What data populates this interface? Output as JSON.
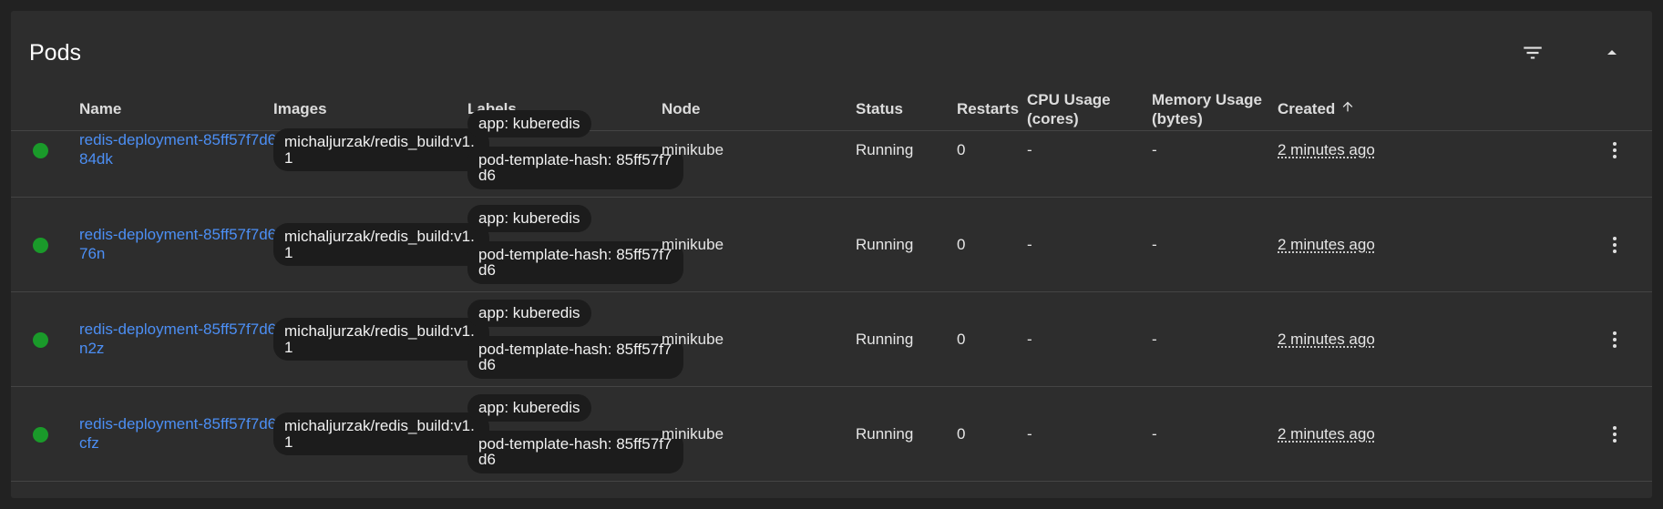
{
  "card": {
    "title": "Pods",
    "filter_icon": "filter-icon",
    "collapse_icon": "chevron-up-icon"
  },
  "columns": {
    "name": "Name",
    "images": "Images",
    "labels": "Labels",
    "node": "Node",
    "status": "Status",
    "restarts": "Restarts",
    "cpu": "CPU Usage (cores)",
    "memory": "Memory Usage (bytes)",
    "created": "Created",
    "created_sort_icon": "arrow-up-icon"
  },
  "rows": [
    {
      "name": "redis-deployment-85ff57f7d6-g84dk",
      "image": "michaljurzak/redis_build:v1.1",
      "label1": "app: kuberedis",
      "label2": "pod-template-hash: 85ff57f7d6",
      "node": "minikube",
      "status": "Running",
      "restarts": "0",
      "cpu": "-",
      "memory": "-",
      "created": "2 minutes ago"
    },
    {
      "name": "redis-deployment-85ff57f7d6-gl76n",
      "image": "michaljurzak/redis_build:v1.1",
      "label1": "app: kuberedis",
      "label2": "pod-template-hash: 85ff57f7d6",
      "node": "minikube",
      "status": "Running",
      "restarts": "0",
      "cpu": "-",
      "memory": "-",
      "created": "2 minutes ago"
    },
    {
      "name": "redis-deployment-85ff57f7d6-gsn2z",
      "image": "michaljurzak/redis_build:v1.1",
      "label1": "app: kuberedis",
      "label2": "pod-template-hash: 85ff57f7d6",
      "node": "minikube",
      "status": "Running",
      "restarts": "0",
      "cpu": "-",
      "memory": "-",
      "created": "2 minutes ago"
    },
    {
      "name": "redis-deployment-85ff57f7d6-tkcfz",
      "image": "michaljurzak/redis_build:v1.1",
      "label1": "app: kuberedis",
      "label2": "pod-template-hash: 85ff57f7d6",
      "node": "minikube",
      "status": "Running",
      "restarts": "0",
      "cpu": "-",
      "memory": "-",
      "created": "2 minutes ago"
    }
  ],
  "colors": {
    "status_ok": "#1a9a2a",
    "link": "#4c8ff5"
  }
}
